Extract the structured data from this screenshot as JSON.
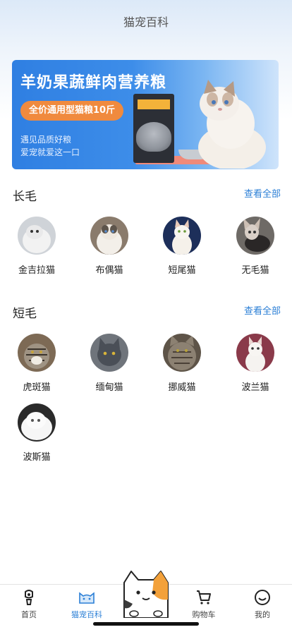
{
  "header": {
    "title": "猫宠百科"
  },
  "banner": {
    "headline": "羊奶果蔬鲜肉营养粮",
    "pill": "全价通用型猫粮10斤",
    "sub1": "遇见品质好粮",
    "sub2": "爱宠就爱这一口"
  },
  "long_hair": {
    "title": "长毛",
    "see_all": "查看全部",
    "items": [
      {
        "name": "金吉拉猫",
        "color": "#cfd3d8"
      },
      {
        "name": "布偶猫",
        "color": "#8a7b6c"
      },
      {
        "name": "短尾猫",
        "color": "#1d2f5a"
      },
      {
        "name": "无毛猫",
        "color": "#6e6a66"
      }
    ]
  },
  "short_hair": {
    "title": "短毛",
    "see_all": "查看全部",
    "items": [
      {
        "name": "虎斑猫",
        "color": "#7d6a55"
      },
      {
        "name": "缅甸猫",
        "color": "#6f747b"
      },
      {
        "name": "挪威猫",
        "color": "#5e5448"
      },
      {
        "name": "波兰猫",
        "color": "#8a3a4a"
      },
      {
        "name": "波斯猫",
        "color": "#2a2a2a"
      }
    ]
  },
  "tabbar": {
    "items": [
      {
        "label": "首页",
        "icon": "home-icon"
      },
      {
        "label": "猫宠百科",
        "icon": "cat-face-icon",
        "active": true
      },
      {
        "label": "购物车",
        "icon": "cart-icon"
      },
      {
        "label": "我的",
        "icon": "smile-icon"
      }
    ]
  },
  "colors": {
    "accent": "#2b7fd6",
    "banner_blue": "#2f7fe2",
    "pill_orange": "#f08a3e"
  }
}
